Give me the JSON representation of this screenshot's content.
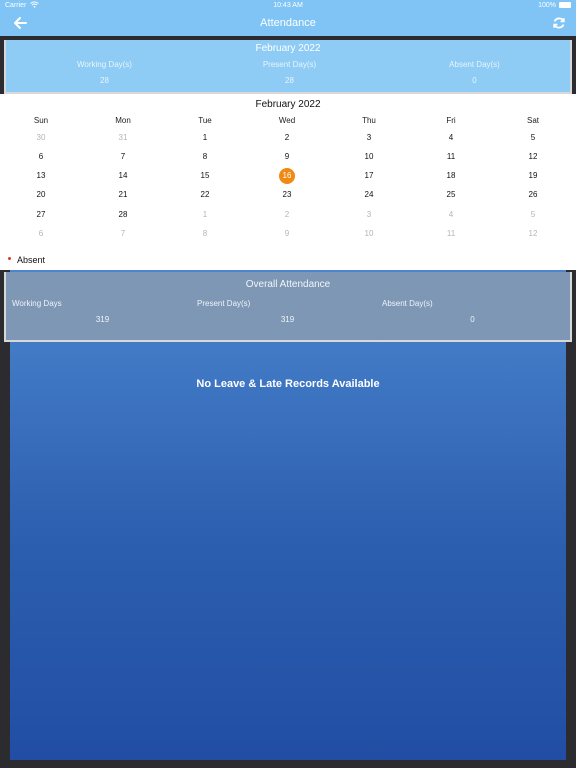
{
  "status_bar": {
    "carrier": "Carrier",
    "time": "10:43 AM",
    "battery": "100%"
  },
  "nav": {
    "title": "Attendance",
    "back_icon": "arrow-left-icon",
    "refresh_icon": "refresh-icon"
  },
  "month_summary": {
    "title": "February 2022",
    "columns": [
      {
        "label": "Working Day(s)",
        "value": "28"
      },
      {
        "label": "Present Day(s)",
        "value": "28"
      },
      {
        "label": "Absent Day(s)",
        "value": "0"
      }
    ]
  },
  "calendar": {
    "title": "February 2022",
    "weekdays": [
      "Sun",
      "Mon",
      "Tue",
      "Wed",
      "Thu",
      "Fri",
      "Sat"
    ],
    "weeks": [
      [
        {
          "d": "30",
          "o": true
        },
        {
          "d": "31",
          "o": true
        },
        {
          "d": "1"
        },
        {
          "d": "2"
        },
        {
          "d": "3"
        },
        {
          "d": "4"
        },
        {
          "d": "5"
        }
      ],
      [
        {
          "d": "6"
        },
        {
          "d": "7"
        },
        {
          "d": "8"
        },
        {
          "d": "9"
        },
        {
          "d": "10"
        },
        {
          "d": "11"
        },
        {
          "d": "12"
        }
      ],
      [
        {
          "d": "13"
        },
        {
          "d": "14"
        },
        {
          "d": "15"
        },
        {
          "d": "16",
          "today": true
        },
        {
          "d": "17"
        },
        {
          "d": "18"
        },
        {
          "d": "19"
        }
      ],
      [
        {
          "d": "20"
        },
        {
          "d": "21"
        },
        {
          "d": "22"
        },
        {
          "d": "23"
        },
        {
          "d": "24"
        },
        {
          "d": "25"
        },
        {
          "d": "26"
        }
      ],
      [
        {
          "d": "27"
        },
        {
          "d": "28"
        },
        {
          "d": "1",
          "o": true
        },
        {
          "d": "2",
          "o": true
        },
        {
          "d": "3",
          "o": true
        },
        {
          "d": "4",
          "o": true
        },
        {
          "d": "5",
          "o": true
        }
      ],
      [
        {
          "d": "6",
          "o": true
        },
        {
          "d": "7",
          "o": true
        },
        {
          "d": "8",
          "o": true
        },
        {
          "d": "9",
          "o": true
        },
        {
          "d": "10",
          "o": true
        },
        {
          "d": "11",
          "o": true
        },
        {
          "d": "12",
          "o": true
        }
      ]
    ],
    "highlight_color": "#f08a14",
    "legend": {
      "label": "Absent",
      "color": "#e23434"
    }
  },
  "overall": {
    "title": "Overall Attendance",
    "columns": [
      {
        "label": "Working Days",
        "value": "319"
      },
      {
        "label": "Present Day(s)",
        "value": "319"
      },
      {
        "label": "Absent Day(s)",
        "value": "0"
      }
    ]
  },
  "no_records": "No Leave & Late Records Available"
}
